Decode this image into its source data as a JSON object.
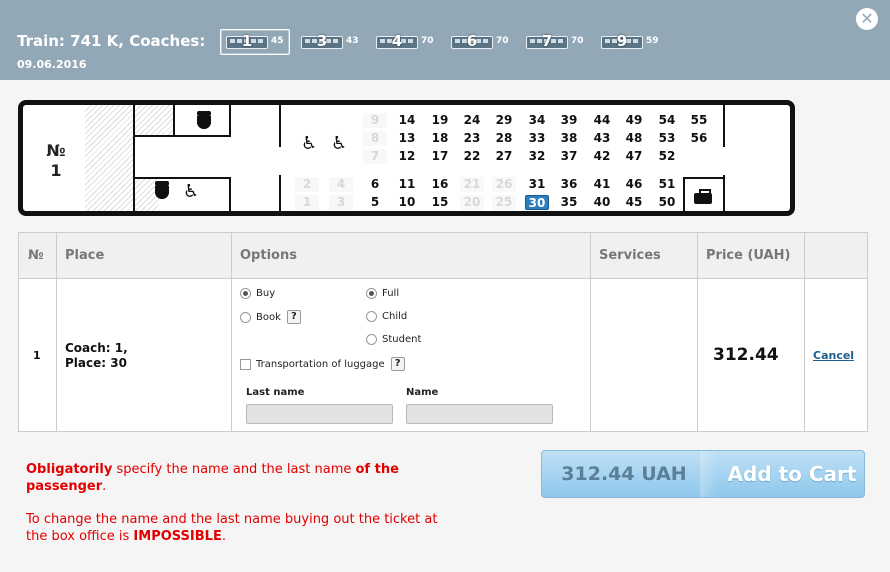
{
  "header": {
    "train_title": "Train: 741 K, Coaches:",
    "date": "09.06.2016",
    "close_glyph": "✕",
    "coaches": [
      {
        "num": "1",
        "free": "45",
        "active": true
      },
      {
        "num": "3",
        "free": "43",
        "active": false
      },
      {
        "num": "4",
        "free": "70",
        "active": false
      },
      {
        "num": "6",
        "free": "70",
        "active": false
      },
      {
        "num": "7",
        "free": "70",
        "active": false
      },
      {
        "num": "9",
        "free": "59",
        "active": false
      }
    ]
  },
  "car": {
    "number_label": "№\n1",
    "icons": [
      "wc-icon",
      "wheelchair-icon",
      "luggage-icon"
    ],
    "seats_busy": [
      "1",
      "2",
      "3",
      "4",
      "7",
      "8",
      "9",
      "20",
      "21",
      "25",
      "26"
    ],
    "seat_selected": "30",
    "seat_labels": [
      "1",
      "2",
      "3",
      "4",
      "5",
      "6",
      "7",
      "8",
      "9",
      "10",
      "11",
      "12",
      "13",
      "14",
      "15",
      "16",
      "17",
      "18",
      "19",
      "20",
      "21",
      "22",
      "23",
      "24",
      "25",
      "26",
      "27",
      "28",
      "29",
      "30",
      "31",
      "32",
      "33",
      "34",
      "35",
      "36",
      "37",
      "38",
      "39",
      "40",
      "41",
      "42",
      "43",
      "44",
      "45",
      "46",
      "47",
      "48",
      "49",
      "50",
      "51",
      "52",
      "53",
      "54",
      "55",
      "56"
    ]
  },
  "table": {
    "headers": {
      "no": "№",
      "place": "Place",
      "options": "Options",
      "services": "Services",
      "price": "Price (UAH)"
    },
    "row": {
      "no": "1",
      "place_line1": "Coach: 1,",
      "place_line2": "Place: 30",
      "opt_buy": "Buy",
      "opt_book": "Book",
      "opt_full": "Full",
      "opt_child": "Child",
      "opt_student": "Student",
      "opt_luggage": "Transportation of luggage",
      "help": "?",
      "last_name_label": "Last name",
      "name_label": "Name",
      "last_name_value": "",
      "name_value": "",
      "price": "312.44",
      "cancel": "Cancel"
    }
  },
  "warning": {
    "p1_a": "Obligatorily",
    "p1_b": " specify the name and the last name ",
    "p1_c": "of the passenger",
    "p1_d": ".",
    "p2_a": "To change the name and the last name buying out the ticket at the box office is ",
    "p2_b": "IMPOSSIBLE",
    "p2_c": "."
  },
  "cart": {
    "price": "312.44 UAH",
    "label": "Add to Cart"
  },
  "colors": {
    "header_bg": "#93a8b6",
    "accent": "#2e7fbe",
    "warning": "#e30000"
  }
}
